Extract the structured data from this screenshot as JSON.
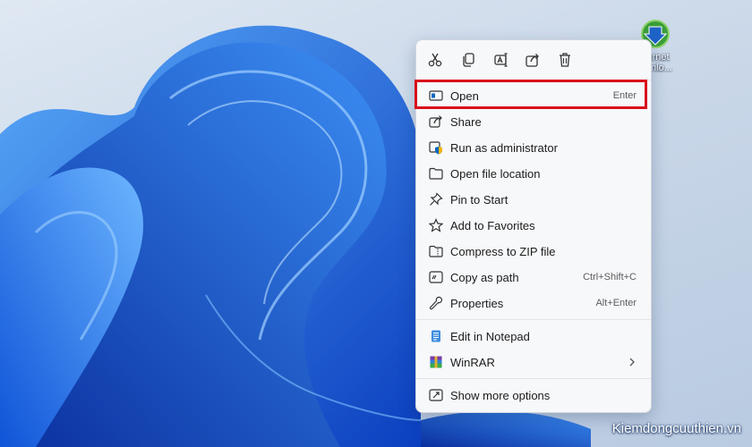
{
  "desktop": {
    "wallpaper": "windows-11-bloom",
    "colors": {
      "background": "#c7d5e6",
      "bloom_dark": "#0b3fbf",
      "bloom_mid": "#1a6ff0",
      "bloom_light": "#5aaaf9"
    },
    "icon": {
      "name": "idm-icon",
      "label_line1": "ernet",
      "label_line2": "wnlo..."
    }
  },
  "quick_actions": [
    {
      "name": "cut-icon"
    },
    {
      "name": "copy-icon"
    },
    {
      "name": "rename-icon"
    },
    {
      "name": "share-icon"
    },
    {
      "name": "delete-icon"
    }
  ],
  "menu": {
    "items": [
      {
        "label": "Open",
        "shortcut": "Enter",
        "icon": "open-icon"
      },
      {
        "label": "Share",
        "shortcut": "",
        "icon": "share-icon"
      },
      {
        "label": "Run as administrator",
        "shortcut": "",
        "icon": "shield-icon"
      },
      {
        "label": "Open file location",
        "shortcut": "",
        "icon": "folder-icon"
      },
      {
        "label": "Pin to Start",
        "shortcut": "",
        "icon": "pin-icon"
      },
      {
        "label": "Add to Favorites",
        "shortcut": "",
        "icon": "star-icon"
      },
      {
        "label": "Compress to ZIP file",
        "shortcut": "",
        "icon": "zip-folder-icon"
      },
      {
        "label": "Copy as path",
        "shortcut": "Ctrl+Shift+C",
        "icon": "copy-path-icon"
      },
      {
        "label": "Properties",
        "shortcut": "Alt+Enter",
        "icon": "wrench-icon"
      },
      {
        "label": "Edit in Notepad",
        "shortcut": "",
        "icon": "notepad-icon"
      },
      {
        "label": "WinRAR",
        "shortcut": "",
        "icon": "winrar-icon"
      },
      {
        "label": "Show more options",
        "shortcut": "",
        "icon": "more-options-icon"
      }
    ],
    "highlight_color": "#d90f1b",
    "accent": "#0067c0"
  },
  "watermark": "Kiemdongcuuthien.vn"
}
